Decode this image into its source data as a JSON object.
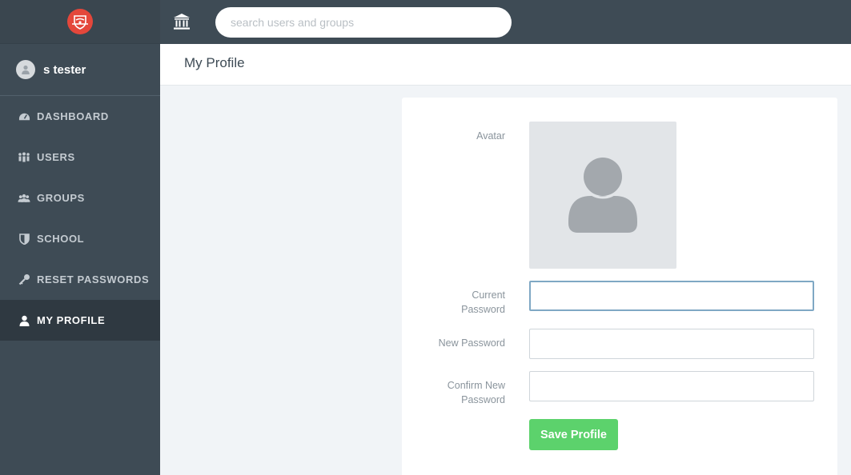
{
  "user": {
    "name": "s tester"
  },
  "sidebar": {
    "items": [
      {
        "label": "DASHBOARD",
        "icon": "dashboard-icon"
      },
      {
        "label": "USERS",
        "icon": "users-icon"
      },
      {
        "label": "GROUPS",
        "icon": "groups-icon"
      },
      {
        "label": "SCHOOL",
        "icon": "shield-icon"
      },
      {
        "label": "RESET PASSWORDS",
        "icon": "key-icon"
      },
      {
        "label": "MY PROFILE",
        "icon": "person-icon",
        "active": true
      }
    ]
  },
  "topbar": {
    "home_icon": "institution-icon",
    "search_placeholder": "search users and groups",
    "search_value": ""
  },
  "page": {
    "title": "My Profile"
  },
  "form": {
    "avatar_label": "Avatar",
    "current_password_label_1": "Current",
    "current_password_label_2": "Password",
    "current_password_value": "",
    "new_password_label": "New Password",
    "new_password_value": "",
    "confirm_label_1": "Confirm New",
    "confirm_label_2": "Password",
    "confirm_value": "",
    "save_label": "Save Profile"
  },
  "colors": {
    "sidebar_bg": "#3e4b55",
    "active_bg": "#2f3941",
    "save_button": "#5cd26c",
    "brand_red": "#e4473b"
  }
}
